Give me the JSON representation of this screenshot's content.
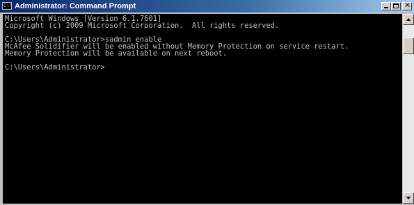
{
  "window": {
    "title": "Administrator: Command Prompt",
    "icon_label": "C:\\",
    "controls": {
      "minimize": "minimize",
      "maximize": "maximize",
      "close": "✕"
    }
  },
  "console": {
    "lines": [
      "Microsoft Windows [Version 6.1.7601]",
      "Copyright (c) 2009 Microsoft Corporation.  All rights reserved.",
      "",
      "C:\\Users\\Administrator>sadmin enable",
      "McAfee Solidifier will be enabled without Memory Protection on service restart.",
      "Memory Protection will be available on next reboot.",
      "",
      "C:\\Users\\Administrator>"
    ]
  },
  "colors": {
    "console_bg": "#000000",
    "console_text": "#c0c0c0",
    "titlebar_start": "#0a246a",
    "titlebar_end": "#a6caf0"
  },
  "icons": [
    "cmd-icon",
    "minimize-icon",
    "maximize-icon",
    "close-icon",
    "scroll-up-arrow-icon",
    "scroll-down-arrow-icon"
  ]
}
